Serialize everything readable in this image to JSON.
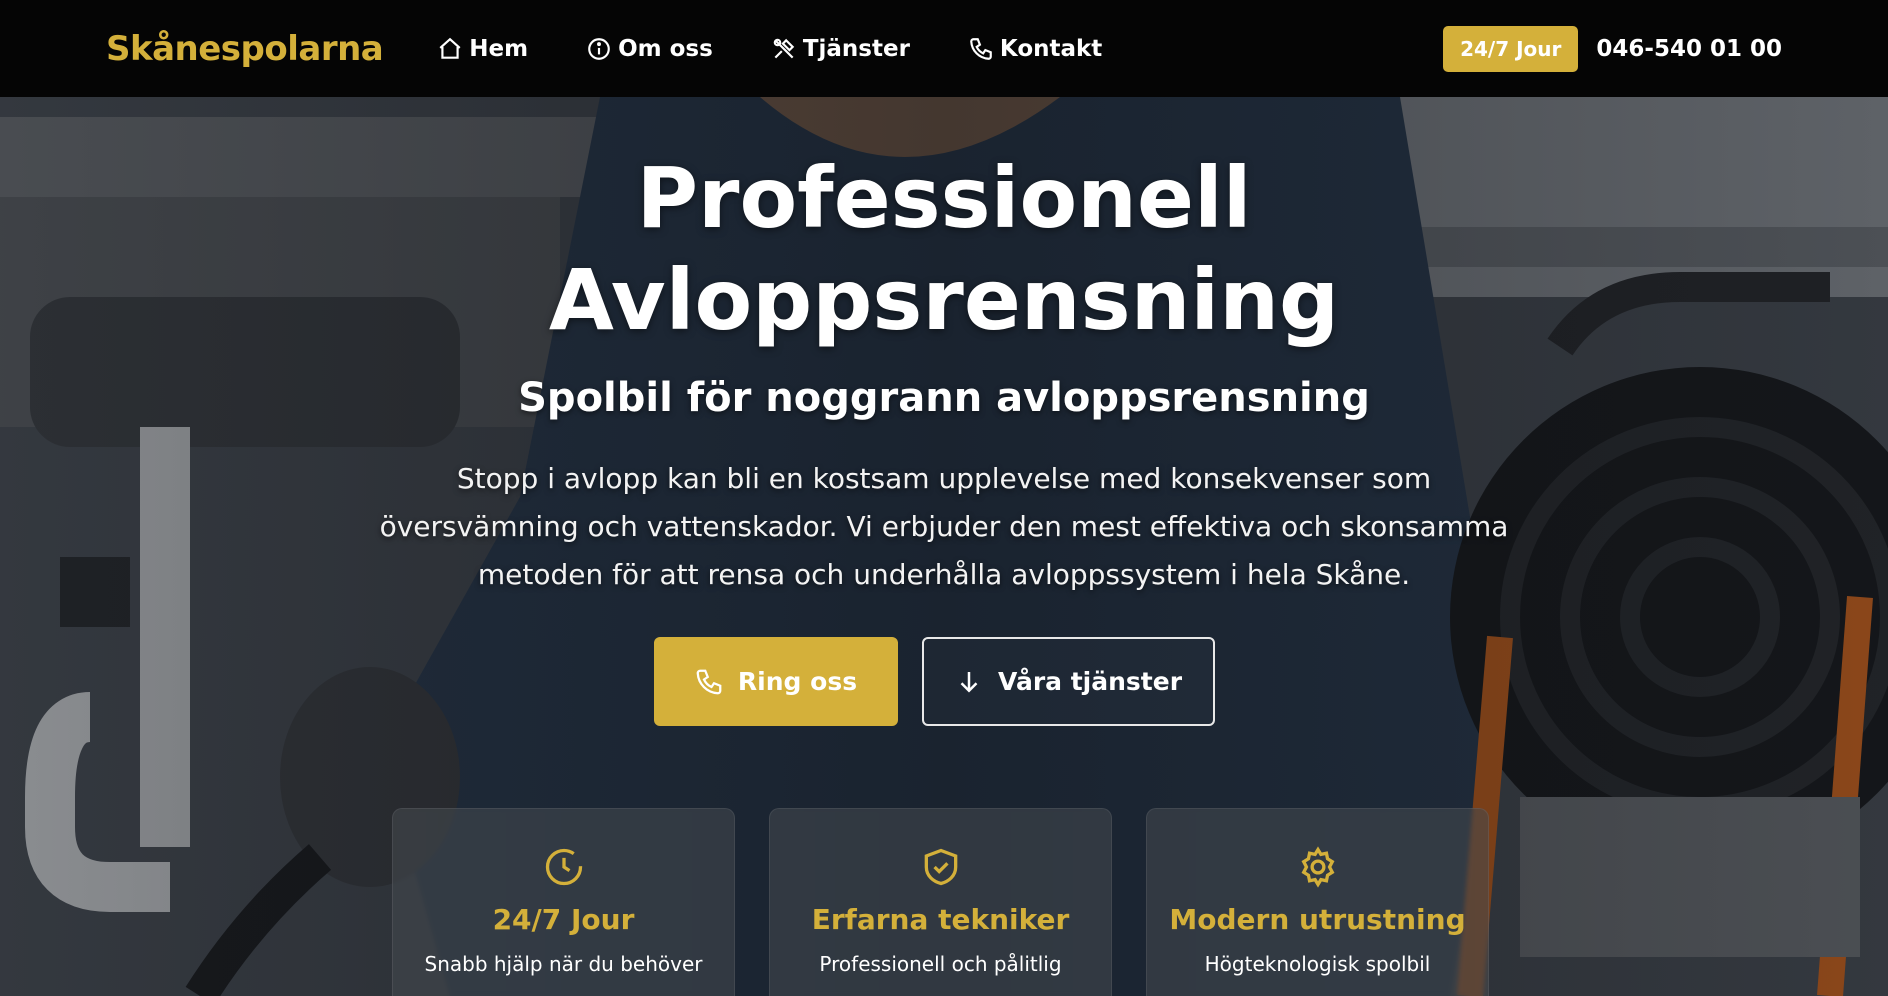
{
  "header": {
    "brand": "Skånespolarna",
    "nav": [
      {
        "label": "Hem",
        "icon": "home-icon"
      },
      {
        "label": "Om oss",
        "icon": "info-icon"
      },
      {
        "label": "Tjänster",
        "icon": "tools-icon"
      },
      {
        "label": "Kontakt",
        "icon": "phone-icon"
      }
    ],
    "badge": "24/7 Jour",
    "phone": "046-540 01 00"
  },
  "hero": {
    "title_line1": "Professionell",
    "title_line2": "Avloppsrensning",
    "subtitle": "Spolbil för noggrann avloppsrensning",
    "description": "Stopp i avlopp kan bli en kostsam upplevelse med konsekvenser som översvämning och vattenskador. Vi erbjuder den mest effektiva och skonsamma metoden för att rensa och underhålla avloppssystem i hela Skåne.",
    "primary_button": "Ring oss",
    "secondary_button": "Våra tjänster"
  },
  "features": [
    {
      "title": "24/7 Jour",
      "text": "Snabb hjälp när du behöver",
      "icon": "clock-icon"
    },
    {
      "title": "Erfarna tekniker",
      "text": "Professionell och pålitlig",
      "icon": "shield-check-icon"
    },
    {
      "title": "Modern utrustning",
      "text": "Högteknologisk spolbil",
      "icon": "gear-icon"
    }
  ],
  "colors": {
    "accent": "#d4b03a",
    "header_bg": "#050505"
  }
}
